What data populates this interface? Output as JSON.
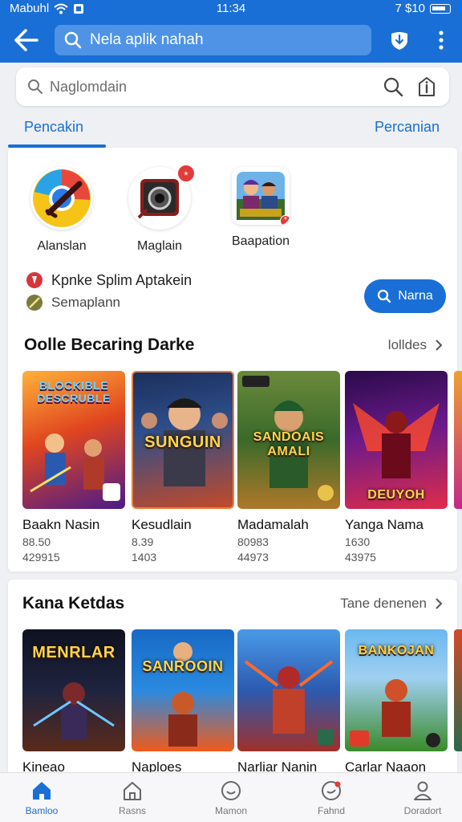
{
  "status": {
    "carrier": "Mabuhl",
    "time": "11:34",
    "right": "7 $10"
  },
  "appbar": {
    "url_text": "Nela aplik nahah"
  },
  "search": {
    "placeholder": "Naglomdain"
  },
  "tabs": {
    "left": "Pencakin",
    "right": "Percanian"
  },
  "quick_items": [
    {
      "label": "Alanslan",
      "icon": "chrome-like-icon"
    },
    {
      "label": "Maglain",
      "icon": "camera-icon",
      "badge": "*"
    },
    {
      "label": "Baapation",
      "icon": "game-poster-icon",
      "badge": "*"
    }
  ],
  "info": {
    "line1": "Kpnke Splim Aptakein",
    "line2": "Semaplann",
    "button": "Narna"
  },
  "section1": {
    "title": "Oolle Becaring Darke",
    "more": "lolldes",
    "games": [
      {
        "name": "Baakn Nasin",
        "price": "88.50",
        "count": "429915",
        "thumb_text": "BLOCKIBLE DESCRUBLE",
        "colors": [
          "#ff7a1a",
          "#6a1fb0"
        ]
      },
      {
        "name": "Kesudlain",
        "price": "8.39",
        "count": "1403",
        "thumb_text": "SUNGUIN",
        "colors": [
          "#1a3f7a",
          "#e0522b"
        ]
      },
      {
        "name": "Madamalah",
        "price": "80983",
        "count": "44973",
        "thumb_text": "SANDOAIS AMALI",
        "colors": [
          "#2f6f2a",
          "#b98a2c"
        ]
      },
      {
        "name": "Yanga Nama",
        "price": "1630",
        "count": "43975",
        "thumb_text": "DEUYOH",
        "colors": [
          "#3a0f5e",
          "#e02c4a"
        ]
      }
    ]
  },
  "section2": {
    "title": "Kana Ketdas",
    "more": "Tane denenen",
    "games": [
      {
        "name": "Kineao",
        "thumb_text": "MENRLAR",
        "colors": [
          "#14161f",
          "#e2a41b"
        ]
      },
      {
        "name": "Naploes",
        "thumb_text": "SANROOIN",
        "colors": [
          "#1769c4",
          "#f05a1a"
        ]
      },
      {
        "name": "Narliar Nanin",
        "thumb_text": "",
        "colors": [
          "#2c7bd6",
          "#d0402a"
        ]
      },
      {
        "name": "Carlar Naaon",
        "thumb_text": "BANKOJAN",
        "colors": [
          "#5bb0f0",
          "#2f8f2a"
        ]
      }
    ]
  },
  "bottom_nav": [
    {
      "label": "Bamloo",
      "icon": "home-icon",
      "active": true
    },
    {
      "label": "Rasns",
      "icon": "house-outline-icon",
      "active": false
    },
    {
      "label": "Mamon",
      "icon": "smile-icon",
      "active": false
    },
    {
      "label": "Fahnd",
      "icon": "clock-icon",
      "active": false
    },
    {
      "label": "Doradort",
      "icon": "person-icon",
      "active": false
    }
  ],
  "colors": {
    "accent": "#1a6fd6",
    "badge": "#e43a3a"
  }
}
